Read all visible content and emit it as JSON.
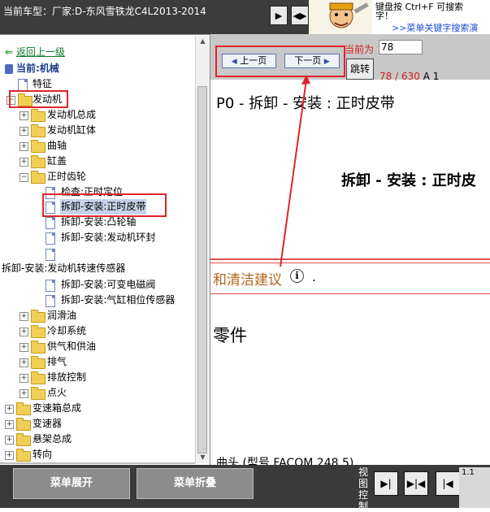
{
  "header": {
    "car_info": "当前车型：厂家:D-东风雪铁龙C4L2013-2014",
    "nav_buttons": [
      "▶",
      "◀▶"
    ],
    "hint_line1": "键盘按   Ctrl+F   可搜索",
    "hint_line2": "字！",
    "hint_link": ">>菜单关键字搜索演"
  },
  "tree": {
    "back": "返回上一级",
    "current": "当前:机械",
    "items": [
      {
        "label": "特征",
        "type": "doc"
      },
      {
        "label": "发动机",
        "type": "folder"
      },
      {
        "label": "发动机总成",
        "type": "folder"
      },
      {
        "label": "发动机缸体",
        "type": "folder"
      },
      {
        "label": "曲轴",
        "type": "folder"
      },
      {
        "label": "缸盖",
        "type": "folder"
      },
      {
        "label": "正时齿轮",
        "type": "folder"
      },
      {
        "label": "检查:正时定位",
        "type": "doc"
      },
      {
        "label": "拆卸-安装:正时皮带",
        "type": "doc"
      },
      {
        "label": "拆卸-安装:凸轮轴",
        "type": "doc"
      },
      {
        "label": "拆卸-安装:发动机环封",
        "type": "doc"
      },
      {
        "label": "",
        "type": "doc"
      },
      {
        "label": "拆卸-安装:发动机转速传感器",
        "type": "text"
      },
      {
        "label": "拆卸-安装:可变电磁阀",
        "type": "doc"
      },
      {
        "label": "拆卸-安装:气缸相位传感器",
        "type": "doc"
      },
      {
        "label": "润滑油",
        "type": "folder"
      },
      {
        "label": "冷却系统",
        "type": "folder"
      },
      {
        "label": "供气和供油",
        "type": "folder"
      },
      {
        "label": "排气",
        "type": "folder"
      },
      {
        "label": "排放控制",
        "type": "folder"
      },
      {
        "label": "点火",
        "type": "folder"
      },
      {
        "label": "变速箱总成",
        "type": "folder"
      },
      {
        "label": "变速器",
        "type": "folder"
      },
      {
        "label": "悬架总成",
        "type": "folder"
      },
      {
        "label": "转向",
        "type": "folder"
      }
    ]
  },
  "pager": {
    "prev": "上一页",
    "next": "下一页",
    "current_label": "当前为",
    "page_value": "78",
    "jump": "跳转",
    "count": "78 / 630",
    "suffix": "A 1"
  },
  "content": {
    "title1": "P0 - 拆卸  - 安装  : 正时皮带",
    "title2": "拆卸  - 安装  : 正时皮",
    "advice": "和清洁建议",
    "info": "i",
    "advice_dot": ".",
    "parts": "零件",
    "bottom_text": "曲头  (型号  FACOM 248.5)"
  },
  "footer": {
    "expand": "菜单展开",
    "collapse": "菜单折叠",
    "view_label": "视图控制",
    "view_buttons": [
      "▶|",
      "▶|◀",
      "|◀"
    ],
    "corner": "1.1"
  },
  "colors": {
    "highlight_box": "#e0242c",
    "link_green": "#0a7a2a",
    "page_red": "#d21f1f",
    "dark_bar": "#3a3a3a"
  }
}
